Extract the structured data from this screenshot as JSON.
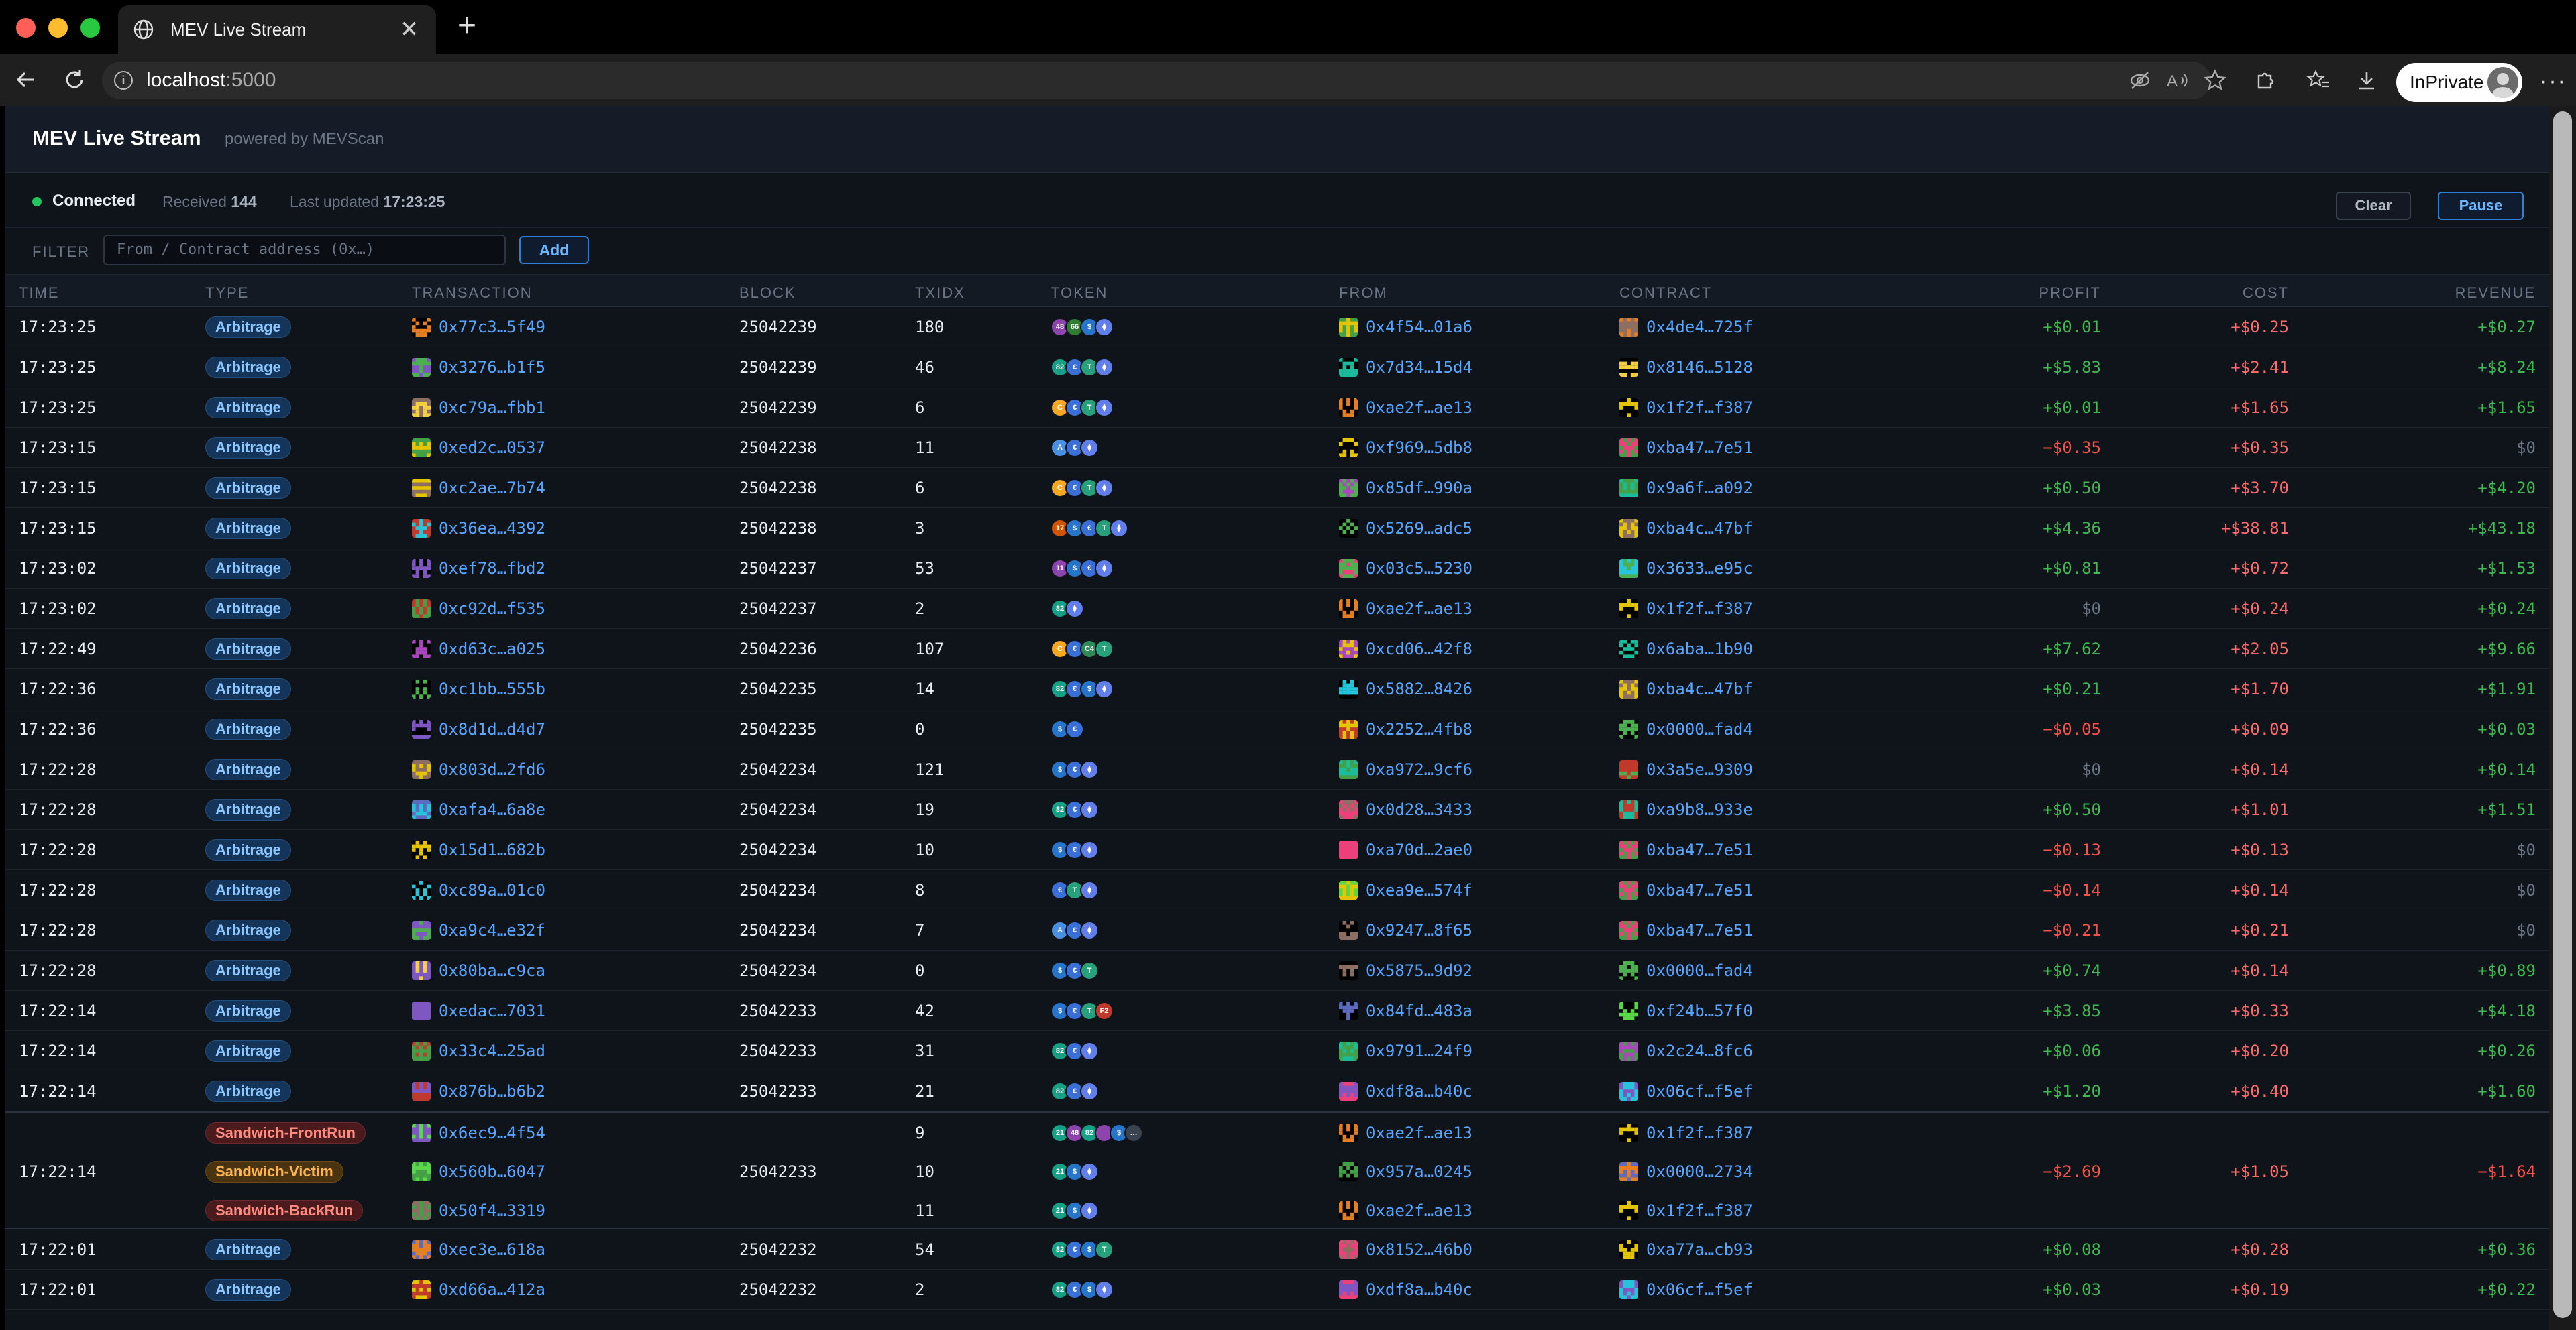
{
  "browser": {
    "tab_title": "MEV Live Stream",
    "url_host": "localhost",
    "url_port": ":5000",
    "inprivate_label": "InPrivate"
  },
  "app": {
    "title": "MEV Live Stream",
    "subtitle": "powered by MEVScan",
    "status": "Connected",
    "received_label": "Received",
    "received_count": "144",
    "updated_label": "Last updated",
    "updated_time": "17:23:25",
    "clear_label": "Clear",
    "pause_label": "Pause",
    "filter_label": "FILTER",
    "filter_placeholder": "From / Contract address (0x…)",
    "add_label": "Add"
  },
  "columns": [
    "TIME",
    "TYPE",
    "TRANSACTION",
    "BLOCK",
    "TXIDX",
    "TOKEN",
    "FROM",
    "CONTRACT",
    "PROFIT",
    "COST",
    "REVENUE"
  ],
  "rows": [
    {
      "time": "17:23:25",
      "type": "Arbitrage",
      "tx": "0x77c3…5f49",
      "block": "25042239",
      "txidx": "180",
      "tokens": [
        "48",
        "66",
        "usdc",
        "eth"
      ],
      "from": "0x4f54…01a6",
      "contract": "0x4de4…725f",
      "profit": "+$0.01",
      "cost": "+$0.25",
      "revenue": "+$0.27"
    },
    {
      "time": "17:23:25",
      "type": "Arbitrage",
      "tx": "0x3276…b1f5",
      "block": "25042239",
      "txidx": "46",
      "tokens": [
        "82",
        "e",
        "t",
        "eth"
      ],
      "from": "0x7d34…15d4",
      "contract": "0x8146…5128",
      "profit": "+$5.83",
      "cost": "+$2.41",
      "revenue": "+$8.24"
    },
    {
      "time": "17:23:25",
      "type": "Arbitrage",
      "tx": "0xc79a…fbb1",
      "block": "25042239",
      "txidx": "6",
      "tokens": [
        "c",
        "e",
        "t",
        "eth"
      ],
      "from": "0xae2f…ae13",
      "contract": "0x1f2f…f387",
      "profit": "+$0.01",
      "cost": "+$1.65",
      "revenue": "+$1.65"
    },
    {
      "time": "17:23:15",
      "type": "Arbitrage",
      "tx": "0xed2c…0537",
      "block": "25042238",
      "txidx": "11",
      "tokens": [
        "a",
        "e",
        "eth"
      ],
      "from": "0xf969…5db8",
      "contract": "0xba47…7e51",
      "profit": "−$0.35",
      "cost": "+$0.35",
      "revenue": "$0"
    },
    {
      "time": "17:23:15",
      "type": "Arbitrage",
      "tx": "0xc2ae…7b74",
      "block": "25042238",
      "txidx": "6",
      "tokens": [
        "c",
        "e",
        "t",
        "eth"
      ],
      "from": "0x85df…990a",
      "contract": "0x9a6f…a092",
      "profit": "+$0.50",
      "cost": "+$3.70",
      "revenue": "+$4.20"
    },
    {
      "time": "17:23:15",
      "type": "Arbitrage",
      "tx": "0x36ea…4392",
      "block": "25042238",
      "txidx": "3",
      "tokens": [
        "17",
        "usdc",
        "e",
        "t",
        "eth"
      ],
      "from": "0x5269…adc5",
      "contract": "0xba4c…47bf",
      "profit": "+$4.36",
      "cost": "+$38.81",
      "revenue": "+$43.18"
    },
    {
      "time": "17:23:02",
      "type": "Arbitrage",
      "tx": "0xef78…fbd2",
      "block": "25042237",
      "txidx": "53",
      "tokens": [
        "11",
        "usdc",
        "e",
        "eth"
      ],
      "from": "0x03c5…5230",
      "contract": "0x3633…e95c",
      "profit": "+$0.81",
      "cost": "+$0.72",
      "revenue": "+$1.53"
    },
    {
      "time": "17:23:02",
      "type": "Arbitrage",
      "tx": "0xc92d…f535",
      "block": "25042237",
      "txidx": "2",
      "tokens": [
        "82",
        "eth"
      ],
      "from": "0xae2f…ae13",
      "contract": "0x1f2f…f387",
      "profit": "$0",
      "cost": "+$0.24",
      "revenue": "+$0.24"
    },
    {
      "time": "17:22:49",
      "type": "Arbitrage",
      "tx": "0xd63c…a025",
      "block": "25042236",
      "txidx": "107",
      "tokens": [
        "c",
        "e",
        "c4",
        "t"
      ],
      "from": "0xcd06…42f8",
      "contract": "0x6aba…1b90",
      "profit": "+$7.62",
      "cost": "+$2.05",
      "revenue": "+$9.66"
    },
    {
      "time": "17:22:36",
      "type": "Arbitrage",
      "tx": "0xc1bb…555b",
      "block": "25042235",
      "txidx": "14",
      "tokens": [
        "82",
        "e",
        "usdc",
        "eth"
      ],
      "from": "0x5882…8426",
      "contract": "0xba4c…47bf",
      "profit": "+$0.21",
      "cost": "+$1.70",
      "revenue": "+$1.91"
    },
    {
      "time": "17:22:36",
      "type": "Arbitrage",
      "tx": "0x8d1d…d4d7",
      "block": "25042235",
      "txidx": "0",
      "tokens": [
        "usdc",
        "e"
      ],
      "from": "0x2252…4fb8",
      "contract": "0x0000…fad4",
      "profit": "−$0.05",
      "cost": "+$0.09",
      "revenue": "+$0.03"
    },
    {
      "time": "17:22:28",
      "type": "Arbitrage",
      "tx": "0x803d…2fd6",
      "block": "25042234",
      "txidx": "121",
      "tokens": [
        "usdc",
        "e",
        "eth"
      ],
      "from": "0xa972…9cf6",
      "contract": "0x3a5e…9309",
      "profit": "$0",
      "cost": "+$0.14",
      "revenue": "+$0.14"
    },
    {
      "time": "17:22:28",
      "type": "Arbitrage",
      "tx": "0xafa4…6a8e",
      "block": "25042234",
      "txidx": "19",
      "tokens": [
        "82",
        "e",
        "eth"
      ],
      "from": "0x0d28…3433",
      "contract": "0xa9b8…933e",
      "profit": "+$0.50",
      "cost": "+$1.01",
      "revenue": "+$1.51"
    },
    {
      "time": "17:22:28",
      "type": "Arbitrage",
      "tx": "0x15d1…682b",
      "block": "25042234",
      "txidx": "10",
      "tokens": [
        "usdc",
        "e",
        "eth"
      ],
      "from": "0xa70d…2ae0",
      "contract": "0xba47…7e51",
      "profit": "−$0.13",
      "cost": "+$0.13",
      "revenue": "$0"
    },
    {
      "time": "17:22:28",
      "type": "Arbitrage",
      "tx": "0xc89a…01c0",
      "block": "25042234",
      "txidx": "8",
      "tokens": [
        "e",
        "t",
        "eth"
      ],
      "from": "0xea9e…574f",
      "contract": "0xba47…7e51",
      "profit": "−$0.14",
      "cost": "+$0.14",
      "revenue": "$0"
    },
    {
      "time": "17:22:28",
      "type": "Arbitrage",
      "tx": "0xa9c4…e32f",
      "block": "25042234",
      "txidx": "7",
      "tokens": [
        "a",
        "e",
        "eth"
      ],
      "from": "0x9247…8f65",
      "contract": "0xba47…7e51",
      "profit": "−$0.21",
      "cost": "+$0.21",
      "revenue": "$0"
    },
    {
      "time": "17:22:28",
      "type": "Arbitrage",
      "tx": "0x80ba…c9ca",
      "block": "25042234",
      "txidx": "0",
      "tokens": [
        "usdc",
        "e",
        "t"
      ],
      "from": "0x5875…9d92",
      "contract": "0x0000…fad4",
      "profit": "+$0.74",
      "cost": "+$0.14",
      "revenue": "+$0.89"
    },
    {
      "time": "17:22:14",
      "type": "Arbitrage",
      "tx": "0xedac…7031",
      "block": "25042233",
      "txidx": "42",
      "tokens": [
        "usdc",
        "e",
        "t",
        "f2"
      ],
      "from": "0x84fd…483a",
      "contract": "0xf24b…57f0",
      "profit": "+$3.85",
      "cost": "+$0.33",
      "revenue": "+$4.18"
    },
    {
      "time": "17:22:14",
      "type": "Arbitrage",
      "tx": "0x33c4…25ad",
      "block": "25042233",
      "txidx": "31",
      "tokens": [
        "82",
        "e",
        "eth"
      ],
      "from": "0x9791…24f9",
      "contract": "0x2c24…8fc6",
      "profit": "+$0.06",
      "cost": "+$0.20",
      "revenue": "+$0.26"
    },
    {
      "time": "17:22:14",
      "type": "Arbitrage",
      "tx": "0x876b…b6b2",
      "block": "25042233",
      "txidx": "21",
      "tokens": [
        "82",
        "e",
        "eth"
      ],
      "from": "0xdf8a…b40c",
      "contract": "0x06cf…f5ef",
      "profit": "+$1.20",
      "cost": "+$0.40",
      "revenue": "+$1.60"
    }
  ],
  "sandwich": {
    "time": "17:22:14",
    "block": "25042233",
    "profit": "−$2.69",
    "cost": "+$1.05",
    "revenue": "−$1.64",
    "legs": [
      {
        "type": "Sandwich-FrontRun",
        "tx": "0x6ec9…4f54",
        "txidx": "9",
        "tokens": [
          "21",
          "48",
          "82",
          "pu",
          "usdc",
          "more"
        ],
        "from": "0xae2f…ae13",
        "contract": "0x1f2f…f387"
      },
      {
        "type": "Sandwich-Victim",
        "tx": "0x560b…6047",
        "txidx": "10",
        "tokens": [
          "21",
          "usdc",
          "eth"
        ],
        "from": "0x957a…0245",
        "contract": "0x0000…2734"
      },
      {
        "type": "Sandwich-BackRun",
        "tx": "0x50f4…3319",
        "txidx": "11",
        "tokens": [
          "21",
          "usdc",
          "eth"
        ],
        "from": "0xae2f…ae13",
        "contract": "0x1f2f…f387"
      }
    ]
  },
  "rows_after": [
    {
      "time": "17:22:01",
      "type": "Arbitrage",
      "tx": "0xec3e…618a",
      "block": "25042232",
      "txidx": "54",
      "tokens": [
        "82",
        "e",
        "usdc",
        "t"
      ],
      "from": "0x8152…46b0",
      "contract": "0xa77a…cb93",
      "profit": "+$0.08",
      "cost": "+$0.28",
      "revenue": "+$0.36"
    },
    {
      "time": "17:22:01",
      "type": "Arbitrage",
      "tx": "0xd66a…412a",
      "block": "25042232",
      "txidx": "2",
      "tokens": [
        "82",
        "e",
        "usdc",
        "eth"
      ],
      "from": "0xdf8a…b40c",
      "contract": "0x06cf…f5ef",
      "profit": "+$0.03",
      "cost": "+$0.19",
      "revenue": "+$0.22"
    }
  ],
  "colors": {
    "accent": "#58a6ff",
    "positive": "#3fb950",
    "negative": "#f85149",
    "connected": "#22c55e"
  }
}
